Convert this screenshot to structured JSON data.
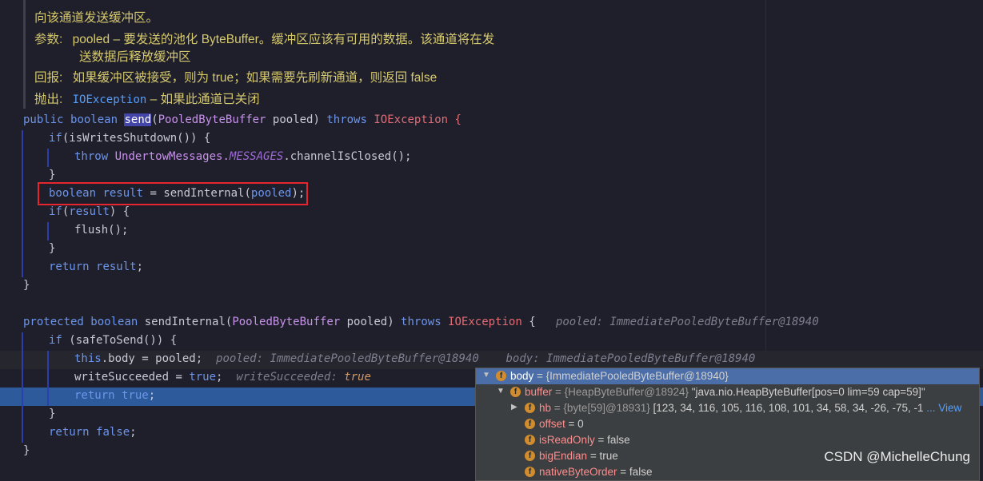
{
  "doc": {
    "line1": "向该通道发送缓冲区。",
    "param_label": "参数:",
    "param_name": "pooled",
    "param_text1": " – 要发送的池化 ByteBuffer。缓冲区应该有可用的数据。该通道将在发",
    "param_text2": "送数据后释放缓冲区",
    "return_label": "回报:",
    "return_text": "如果缓冲区被接受，则为 true；如果需要先刷新通道，则返回 false",
    "throws_label": "抛出:",
    "throws_class": "IOException",
    "throws_text": " – 如果此通道已关闭"
  },
  "code": {
    "l1_public": "public",
    "l1_boolean": "boolean",
    "l1_send": "send",
    "l1_paren": "(",
    "l1_type": "PooledByteBuffer",
    "l1_param": " pooled) ",
    "l1_throws": "throws",
    "l1_ex": "IOException",
    "l1_brace": " {",
    "l2_if": "if",
    "l2_rest": "(isWritesShutdown()) {",
    "l3_throw": "throw",
    "l3_cls": "UndertowMessages.",
    "l3_static": "MESSAGES",
    "l3_rest": ".channelIsClosed();",
    "l4": "}",
    "l5_boolean": "boolean",
    "l5_result": "result",
    "l5_rest": " = sendInternal(",
    "l5_arg": "pooled",
    "l5_end": ");",
    "l6_if": "if",
    "l6_rest": "(",
    "l6_var": "result",
    "l6_end": ") {",
    "l7": "flush();",
    "l8": "}",
    "l9_return": "return",
    "l9_var": "result",
    "l9_end": ";",
    "l10": "}",
    "l12_protected": "protected",
    "l12_boolean": "boolean",
    "l12_name": " sendInternal(",
    "l12_type": "PooledByteBuffer",
    "l12_param": " pooled) ",
    "l12_throws": "throws",
    "l12_ex": "IOException",
    "l12_brace": " {",
    "l12_hint": "pooled: ImmediatePooledByteBuffer@18940",
    "l13_if": "if",
    "l13_rest": " (safeToSend()) {",
    "l14_this": "this",
    "l14_body": ".body",
    "l14_rest": " = pooled;",
    "l14_hint1": "pooled: ImmediatePooledByteBuffer@18940",
    "l14_hint2": "body: ImmediatePooledByteBuffer@18940",
    "l15_var": "writeSucceeded",
    "l15_rest": " = ",
    "l15_true": "true",
    "l15_end": ";",
    "l15_hint_name": "writeSucceeded: ",
    "l15_hint_val": "true",
    "l16_return": "return",
    "l16_true": "true",
    "l16_end": ";",
    "l17": "}",
    "l18_return": "return",
    "l18_false": "false",
    "l18_end": ";",
    "l19": "}"
  },
  "debugger": {
    "row1_name": "body",
    "row1_value": " = {ImmediatePooledByteBuffer@18940}",
    "row2_name": "buffer",
    "row2_ref": " = {HeapByteBuffer@18924} ",
    "row2_value": "\"java.nio.HeapByteBuffer[pos=0 lim=59 cap=59]\"",
    "row3_name": "hb",
    "row3_ref": " = {byte[59]@18931} ",
    "row3_value": "[123, 34, 116, 105, 116, 108, 101, 34, 58, 34, -26, -75, -1",
    "row3_link": "... View",
    "row4_name": "offset",
    "row4_value": " = 0",
    "row5_name": "isReadOnly",
    "row5_value": " = false",
    "row6_name": "bigEndian",
    "row6_value": " = true",
    "row7_name": "nativeByteOrder",
    "row7_value": " = false",
    "field_badge": "f"
  },
  "watermark": "CSDN @MichelleChung",
  "colors": {
    "keyword": "#6c95eb",
    "exception": "#e06c75",
    "selection": "#2d5a9a",
    "highlight_box": "#e5262f"
  }
}
